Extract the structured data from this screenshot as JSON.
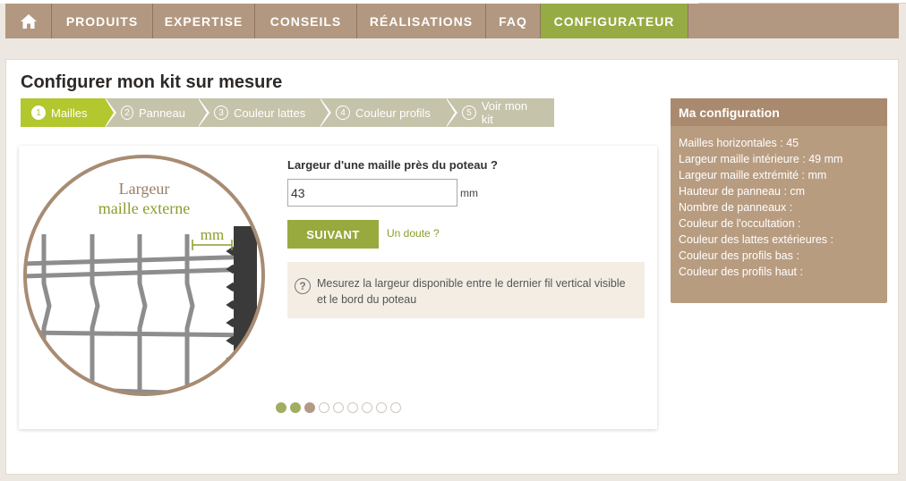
{
  "nav": {
    "home_icon": "home-icon",
    "items": [
      {
        "label": "PRODUITS",
        "active": false
      },
      {
        "label": "EXPERTISE",
        "active": false
      },
      {
        "label": "CONSEILS",
        "active": false
      },
      {
        "label": "RÉALISATIONS",
        "active": false
      },
      {
        "label": "FAQ",
        "active": false
      },
      {
        "label": "CONFIGURATEUR",
        "active": true
      }
    ]
  },
  "page": {
    "title": "Configurer mon kit sur mesure"
  },
  "steps": [
    {
      "num": "1",
      "label": "Mailles",
      "active": true
    },
    {
      "num": "2",
      "label": "Panneau",
      "active": false
    },
    {
      "num": "3",
      "label": "Couleur lattes",
      "active": false
    },
    {
      "num": "4",
      "label": "Couleur profils",
      "active": false
    },
    {
      "num": "5",
      "label": "Voir mon kit",
      "active": false
    }
  ],
  "illustration": {
    "line1": "Largeur",
    "line2": "maille externe",
    "unit": "mm"
  },
  "form": {
    "question": "Largeur d'une maille près du poteau ?",
    "value": "43",
    "unit": "mm",
    "next_label": "SUIVANT",
    "doubt_label": "Un doute ?",
    "help_icon": "question-circle-icon",
    "help_text": "Mesurez la largeur disponible entre le dernier fil vertical visible et le bord du poteau"
  },
  "progress": {
    "total": 9,
    "done": 2,
    "current": 3
  },
  "config": {
    "title": "Ma configuration",
    "lines": [
      "Mailles horizontales : 45",
      "Largeur maille intérieure : 49 mm",
      "Largeur maille extrémité : mm",
      "Hauteur de panneau : cm",
      "Nombre de panneaux :",
      "Couleur de l'occultation :",
      "Couleur des lattes extérieures :",
      "Couleur des profils bas :",
      "Couleur des profils haut :"
    ]
  },
  "colors": {
    "nav_bg": "#b29880",
    "nav_active": "#97ab44",
    "step_active": "#b3c72e",
    "step_inactive": "#c6c3ab",
    "button": "#98a93e",
    "side_bg": "#b89c80"
  }
}
